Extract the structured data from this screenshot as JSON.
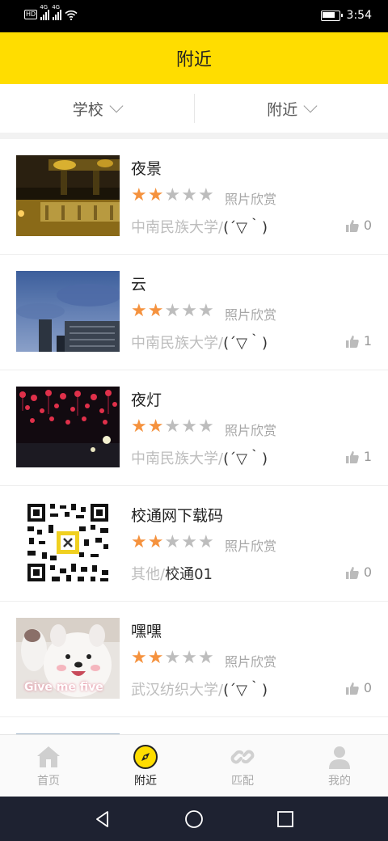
{
  "status_bar": {
    "time": "3:54",
    "network_label": "4G",
    "hd_label": "HD"
  },
  "header": {
    "title": "附近"
  },
  "filters": [
    {
      "label": "学校"
    },
    {
      "label": "附近"
    }
  ],
  "items": [
    {
      "title": "夜景",
      "rating": 2,
      "max_rating": 5,
      "category": "照片欣赏",
      "school": "中南民族大学/",
      "author": "(´▽｀)",
      "likes": "0",
      "image": "night-bridge-photo"
    },
    {
      "title": "云",
      "rating": 2,
      "max_rating": 5,
      "category": "照片欣赏",
      "school": "中南民族大学/",
      "author": "(´▽｀)",
      "likes": "1",
      "image": "cloudy-sky-photo"
    },
    {
      "title": "夜灯",
      "rating": 2,
      "max_rating": 5,
      "category": "照片欣赏",
      "school": "中南民族大学/",
      "author": "(´▽｀)",
      "likes": "1",
      "image": "red-lanterns-photo"
    },
    {
      "title": "校通网下载码",
      "rating": 2,
      "max_rating": 5,
      "category": "照片欣赏",
      "school": "其他/",
      "author": "校通01",
      "likes": "0",
      "image": "qr-code"
    },
    {
      "title": "嘿嘿",
      "rating": 2,
      "max_rating": 5,
      "category": "照片欣赏",
      "school": "武汉纺织大学/",
      "author": "(´▽｀)",
      "likes": "0",
      "image": "white-dog-photo",
      "image_caption": "Give me five"
    }
  ],
  "tabbar": [
    {
      "label": "首页",
      "icon": "home-icon",
      "active": false
    },
    {
      "label": "附近",
      "icon": "compass-icon",
      "active": true
    },
    {
      "label": "匹配",
      "icon": "link-icon",
      "active": false
    },
    {
      "label": "我的",
      "icon": "person-icon",
      "active": false
    }
  ],
  "colors": {
    "accent": "#FFDD00",
    "star_on": "#F5923E",
    "star_off": "#BDBDBD",
    "navbar": "#1E2231"
  }
}
